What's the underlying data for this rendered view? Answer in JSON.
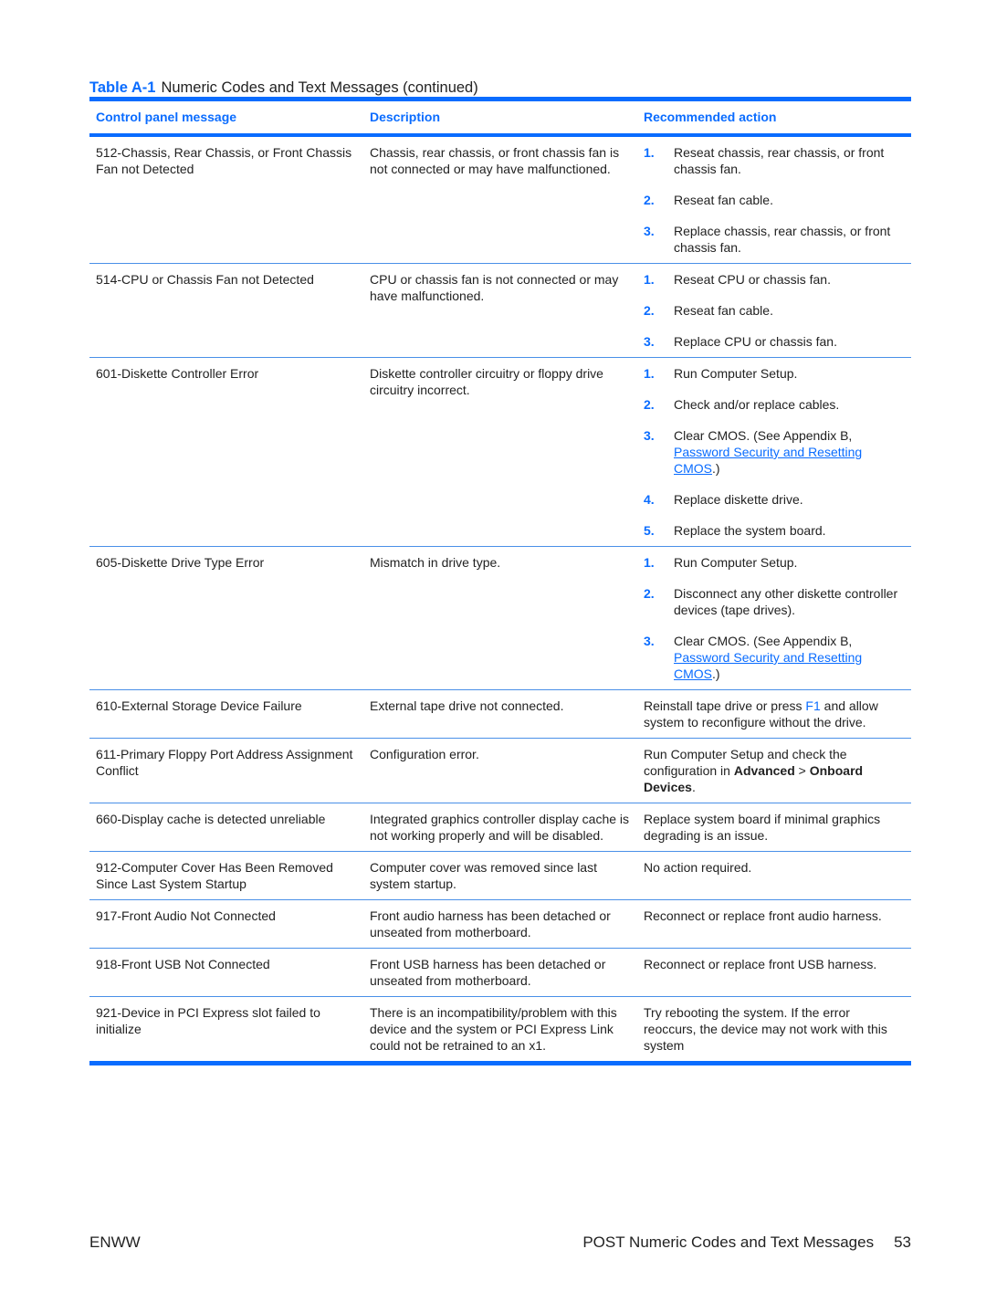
{
  "title": {
    "label": "Table A-1",
    "text": "Numeric Codes and Text Messages (continued)"
  },
  "headers": [
    "Control panel message",
    "Description",
    "Recommended action"
  ],
  "rows": [
    {
      "message": "512-Chassis, Rear Chassis, or Front Chassis Fan not Detected",
      "description": "Chassis, rear chassis, or front chassis fan is not connected or may have malfunctioned.",
      "steps": [
        {
          "num": "1.",
          "text": "Reseat chassis, rear chassis, or front chassis fan."
        },
        {
          "num": "2.",
          "text": "Reseat fan cable."
        },
        {
          "num": "3.",
          "text": "Replace chassis, rear chassis, or front chassis fan."
        }
      ]
    },
    {
      "message": "514-CPU or Chassis Fan not Detected",
      "description": "CPU or chassis fan is not connected or may have malfunctioned.",
      "steps": [
        {
          "num": "1.",
          "text": "Reseat CPU or chassis fan."
        },
        {
          "num": "2.",
          "text": "Reseat fan cable."
        },
        {
          "num": "3.",
          "text": "Replace CPU or chassis fan."
        }
      ]
    },
    {
      "message": "601-Diskette Controller Error",
      "description": "Diskette controller circuitry or floppy drive circuitry incorrect.",
      "steps": [
        {
          "num": "1.",
          "text": "Run Computer Setup."
        },
        {
          "num": "2.",
          "text": "Check and/or replace cables."
        },
        {
          "num": "3.",
          "text_before": "Clear CMOS. (See Appendix B, ",
          "link": "Password Security and Resetting CMOS",
          "text_after": ".)"
        },
        {
          "num": "4.",
          "text": "Replace diskette drive."
        },
        {
          "num": "5.",
          "text": "Replace the system board."
        }
      ]
    },
    {
      "message": "605-Diskette Drive Type Error",
      "description": "Mismatch in drive type.",
      "steps": [
        {
          "num": "1.",
          "text": "Run Computer Setup."
        },
        {
          "num": "2.",
          "text": "Disconnect any other diskette controller devices (tape drives)."
        },
        {
          "num": "3.",
          "text_before": "Clear CMOS. (See Appendix B, ",
          "link": "Password Security and Resetting CMOS",
          "text_after": ".)"
        }
      ]
    },
    {
      "message": "610-External Storage Device Failure",
      "description": "External tape drive not connected.",
      "action_before": "Reinstall tape drive or press ",
      "action_key": "F1",
      "action_after": " and allow system to reconfigure without the drive."
    },
    {
      "message": "611-Primary Floppy Port Address Assignment Conflict",
      "description": "Configuration error.",
      "action_before": "Run Computer Setup and check the configuration in ",
      "action_bold1": "Advanced",
      "action_sep": " > ",
      "action_bold2": "Onboard Devices",
      "action_after": "."
    },
    {
      "message": "660-Display cache is detected unreliable",
      "description": "Integrated graphics controller display cache is not working properly and will be disabled.",
      "action": "Replace system board if minimal graphics degrading is an issue."
    },
    {
      "message": "912-Computer Cover Has Been Removed Since Last System Startup",
      "description": "Computer cover was removed since last system startup.",
      "action": "No action required."
    },
    {
      "message": "917-Front Audio Not Connected",
      "description": "Front audio harness has been detached or unseated from motherboard.",
      "action": "Reconnect or replace front audio harness."
    },
    {
      "message": "918-Front USB Not Connected",
      "description": "Front USB harness has been detached or unseated from motherboard.",
      "action": "Reconnect or replace front USB harness."
    },
    {
      "message": "921-Device in PCI Express slot failed to initialize",
      "description": "There is an incompatibility/problem with this device and the system or PCI Express Link could not be retrained to an x1.",
      "action": "Try rebooting the system. If the error reoccurs, the device may not work with this system"
    }
  ],
  "footer": {
    "left": "ENWW",
    "section": "POST Numeric Codes and Text Messages",
    "page": "53"
  }
}
